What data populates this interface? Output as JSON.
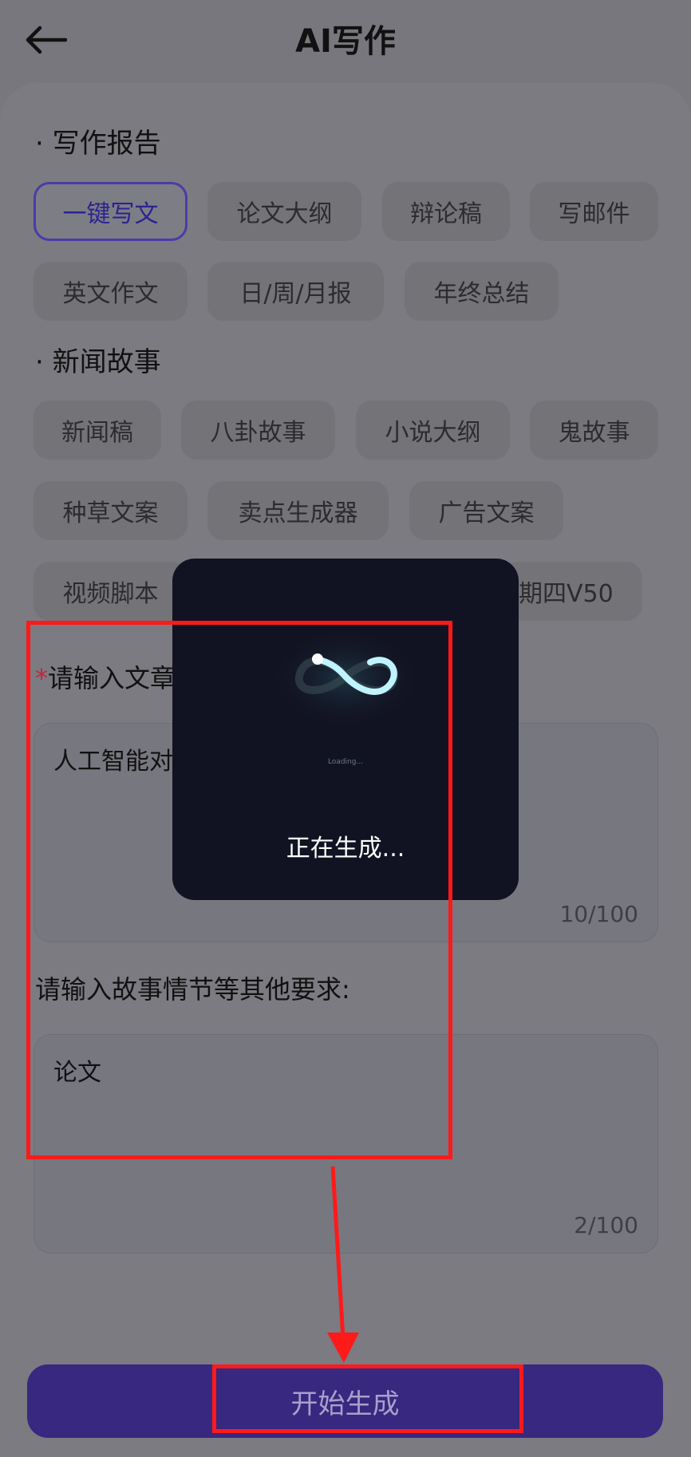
{
  "header": {
    "title": "AI写作",
    "back_icon": "arrow-left-icon"
  },
  "sections": [
    {
      "title": "· 写作报告",
      "chips": [
        "一键写文",
        "论文大纲",
        "辩论稿",
        "写邮件",
        "英文作文",
        "日/周/月报",
        "年终总结"
      ],
      "selected": "一键写文"
    },
    {
      "title": "· 新闻故事",
      "chips": [
        "新闻稿",
        "八卦故事",
        "小说大纲",
        "鬼故事",
        "种草文案",
        "卖点生成器",
        "广告文案",
        "视频脚本",
        "期四V50"
      ]
    }
  ],
  "form": {
    "article_label_required_mark": "*",
    "article_label": "请输入文章",
    "article_value": "人工智能对",
    "article_count": "10/100",
    "requirements_label": "请输入故事情节等其他要求:",
    "requirements_value": "论文",
    "requirements_count": "2/100"
  },
  "overlay": {
    "loading_caption": "Loading...",
    "message": "正在生成..."
  },
  "footer": {
    "start_button": "开始生成"
  },
  "colors": {
    "accent": "#38287f",
    "annotation": "#ff1a1a",
    "overlay_bg": "#121322"
  }
}
